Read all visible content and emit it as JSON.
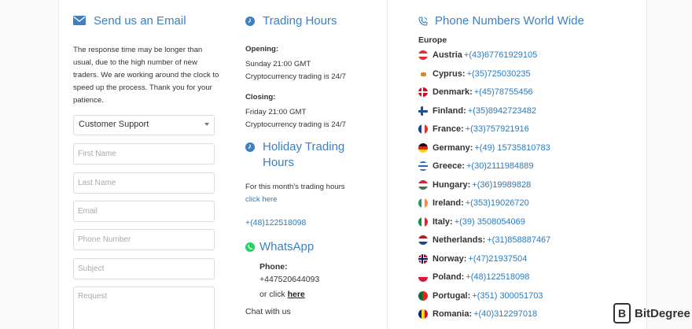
{
  "email": {
    "title": "Send us an Email",
    "description": "The response time may be longer than usual, due to the high number of new traders. We are working around the clock to speed up the process. Thank you for your patience.",
    "department_selected": "Customer Support",
    "first_name_placeholder": "First Name",
    "last_name_placeholder": "Last Name",
    "email_placeholder": "Email",
    "phone_placeholder": "Phone Number",
    "subject_placeholder": "Subject",
    "request_placeholder": "Request"
  },
  "trading": {
    "title": "Trading Hours",
    "opening_label": "Opening:",
    "opening_time": "Sunday 21:00 GMT",
    "opening_crypto": "Cryptocurrency trading is 24/7",
    "closing_label": "Closing:",
    "closing_time": "Friday 21:00 GMT",
    "closing_crypto": "Cryptocurrency trading is 24/7"
  },
  "holiday": {
    "title_line1": "Holiday Trading",
    "title_line2": "Hours",
    "text": "For this month's trading hours",
    "link": "click here",
    "phone": "+(48)122518098"
  },
  "whatsapp": {
    "title": "WhatsApp",
    "phone_label": "Phone:",
    "phone_number": "+447520644093",
    "or_click": "or click ",
    "here_link": "here",
    "chat_text": "Chat with us"
  },
  "phones": {
    "title": "Phone Numbers World Wide",
    "region": "Europe",
    "entries": [
      {
        "country": "Austria",
        "number": "+(43)67761929105"
      },
      {
        "country": "Cyprus:",
        "number": "+(35)725030235"
      },
      {
        "country": "Denmark:",
        "number": "+(45)78755456"
      },
      {
        "country": "Finland:",
        "number": "+(35)8942723482"
      },
      {
        "country": "France:",
        "number": "+(33)757921916"
      },
      {
        "country": "Germany:",
        "number": "+(49) 15735810783"
      },
      {
        "country": "Greece:",
        "number": "+(30)2111984889"
      },
      {
        "country": "Hungary:",
        "number": "+(36)19989828"
      },
      {
        "country": "Ireland:",
        "number": "+(353)19026720"
      },
      {
        "country": "Italy:",
        "number": "+(39) 3508054069"
      },
      {
        "country": "Netherlands:",
        "number": "+(31)858887467"
      },
      {
        "country": "Norway:",
        "number": "+(47)21937504"
      },
      {
        "country": "Poland:",
        "number": "+(48)122518098"
      },
      {
        "country": "Portugal:",
        "number": "+(351) 300051703"
      },
      {
        "country": "Romania:",
        "number": "+(40)312297018"
      }
    ]
  },
  "brand": {
    "logo_letter": "B",
    "name": "BitDegree"
  },
  "colors": {
    "accent": "#3d7fc1",
    "link": "#2a7bbf",
    "whatsapp": "#25d366"
  }
}
